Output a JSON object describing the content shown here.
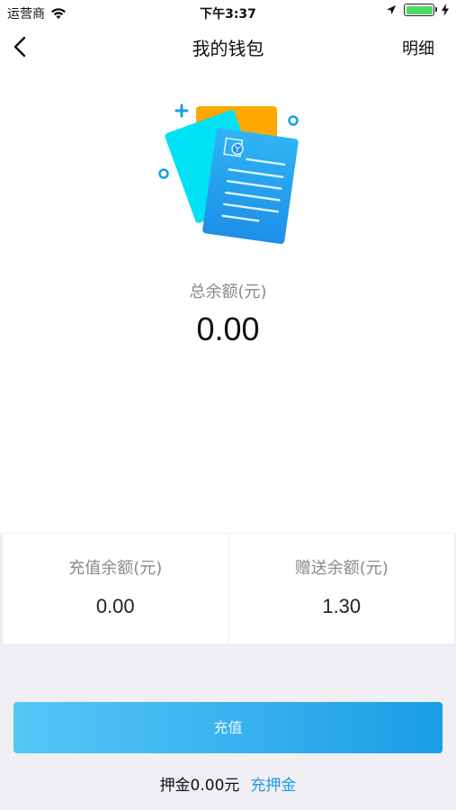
{
  "status_bar": {
    "carrier": "运营商",
    "time": "下午3:37"
  },
  "nav": {
    "title": "我的钱包",
    "detail_label": "明细"
  },
  "wallet": {
    "total_label": "总余额(元)",
    "total_value": "0.00"
  },
  "balances": {
    "recharge_label": "充值余额(元)",
    "recharge_value": "0.00",
    "gift_label": "赠送余额(元)",
    "gift_value": "1.30"
  },
  "actions": {
    "recharge_button": "充值",
    "deposit_text": "押金0.00元",
    "deposit_link": "充押金"
  },
  "colors": {
    "accent": "#1f9ae6",
    "button_start": "#55c8f7",
    "button_end": "#1a9ee6",
    "battery": "#4cd964"
  }
}
